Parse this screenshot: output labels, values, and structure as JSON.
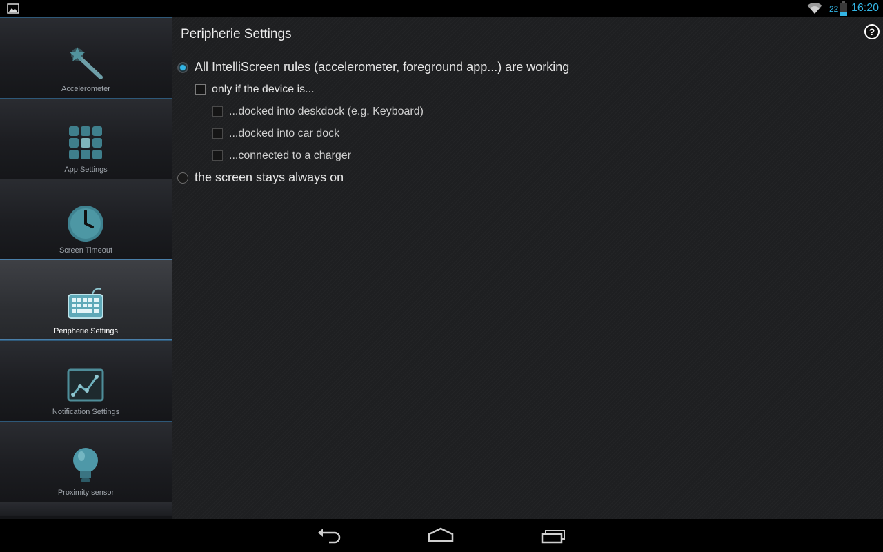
{
  "status_bar": {
    "battery_level": "22",
    "time": "16:20"
  },
  "sidebar": {
    "items": [
      {
        "label": "Accelerometer",
        "icon": "magic-wand-icon",
        "selected": false
      },
      {
        "label": "App Settings",
        "icon": "app-grid-icon",
        "selected": false
      },
      {
        "label": "Screen Timeout",
        "icon": "clock-icon",
        "selected": false
      },
      {
        "label": "Peripherie Settings",
        "icon": "keyboard-icon",
        "selected": true
      },
      {
        "label": "Notification Settings",
        "icon": "chart-icon",
        "selected": false
      },
      {
        "label": "Proximity sensor",
        "icon": "light-bulb-icon",
        "selected": false
      }
    ]
  },
  "main": {
    "title": "Peripherie Settings",
    "help_label": "?",
    "options": {
      "rules_working": {
        "label": "All IntelliScreen rules (accelerometer, foreground app...) are working",
        "checked": true
      },
      "only_if_device": {
        "label": "only if the device is...",
        "checked": false
      },
      "deskdock": {
        "label": "...docked into deskdock (e.g. Keyboard)",
        "checked": false
      },
      "car_dock": {
        "label": "...docked into car dock",
        "checked": false
      },
      "charger": {
        "label": "...connected to a charger",
        "checked": false
      },
      "always_on": {
        "label": "the screen stays always on",
        "checked": false
      }
    }
  },
  "colors": {
    "accent": "#33b5e5",
    "divider": "#3d6c92",
    "background": "#1e1f21"
  }
}
